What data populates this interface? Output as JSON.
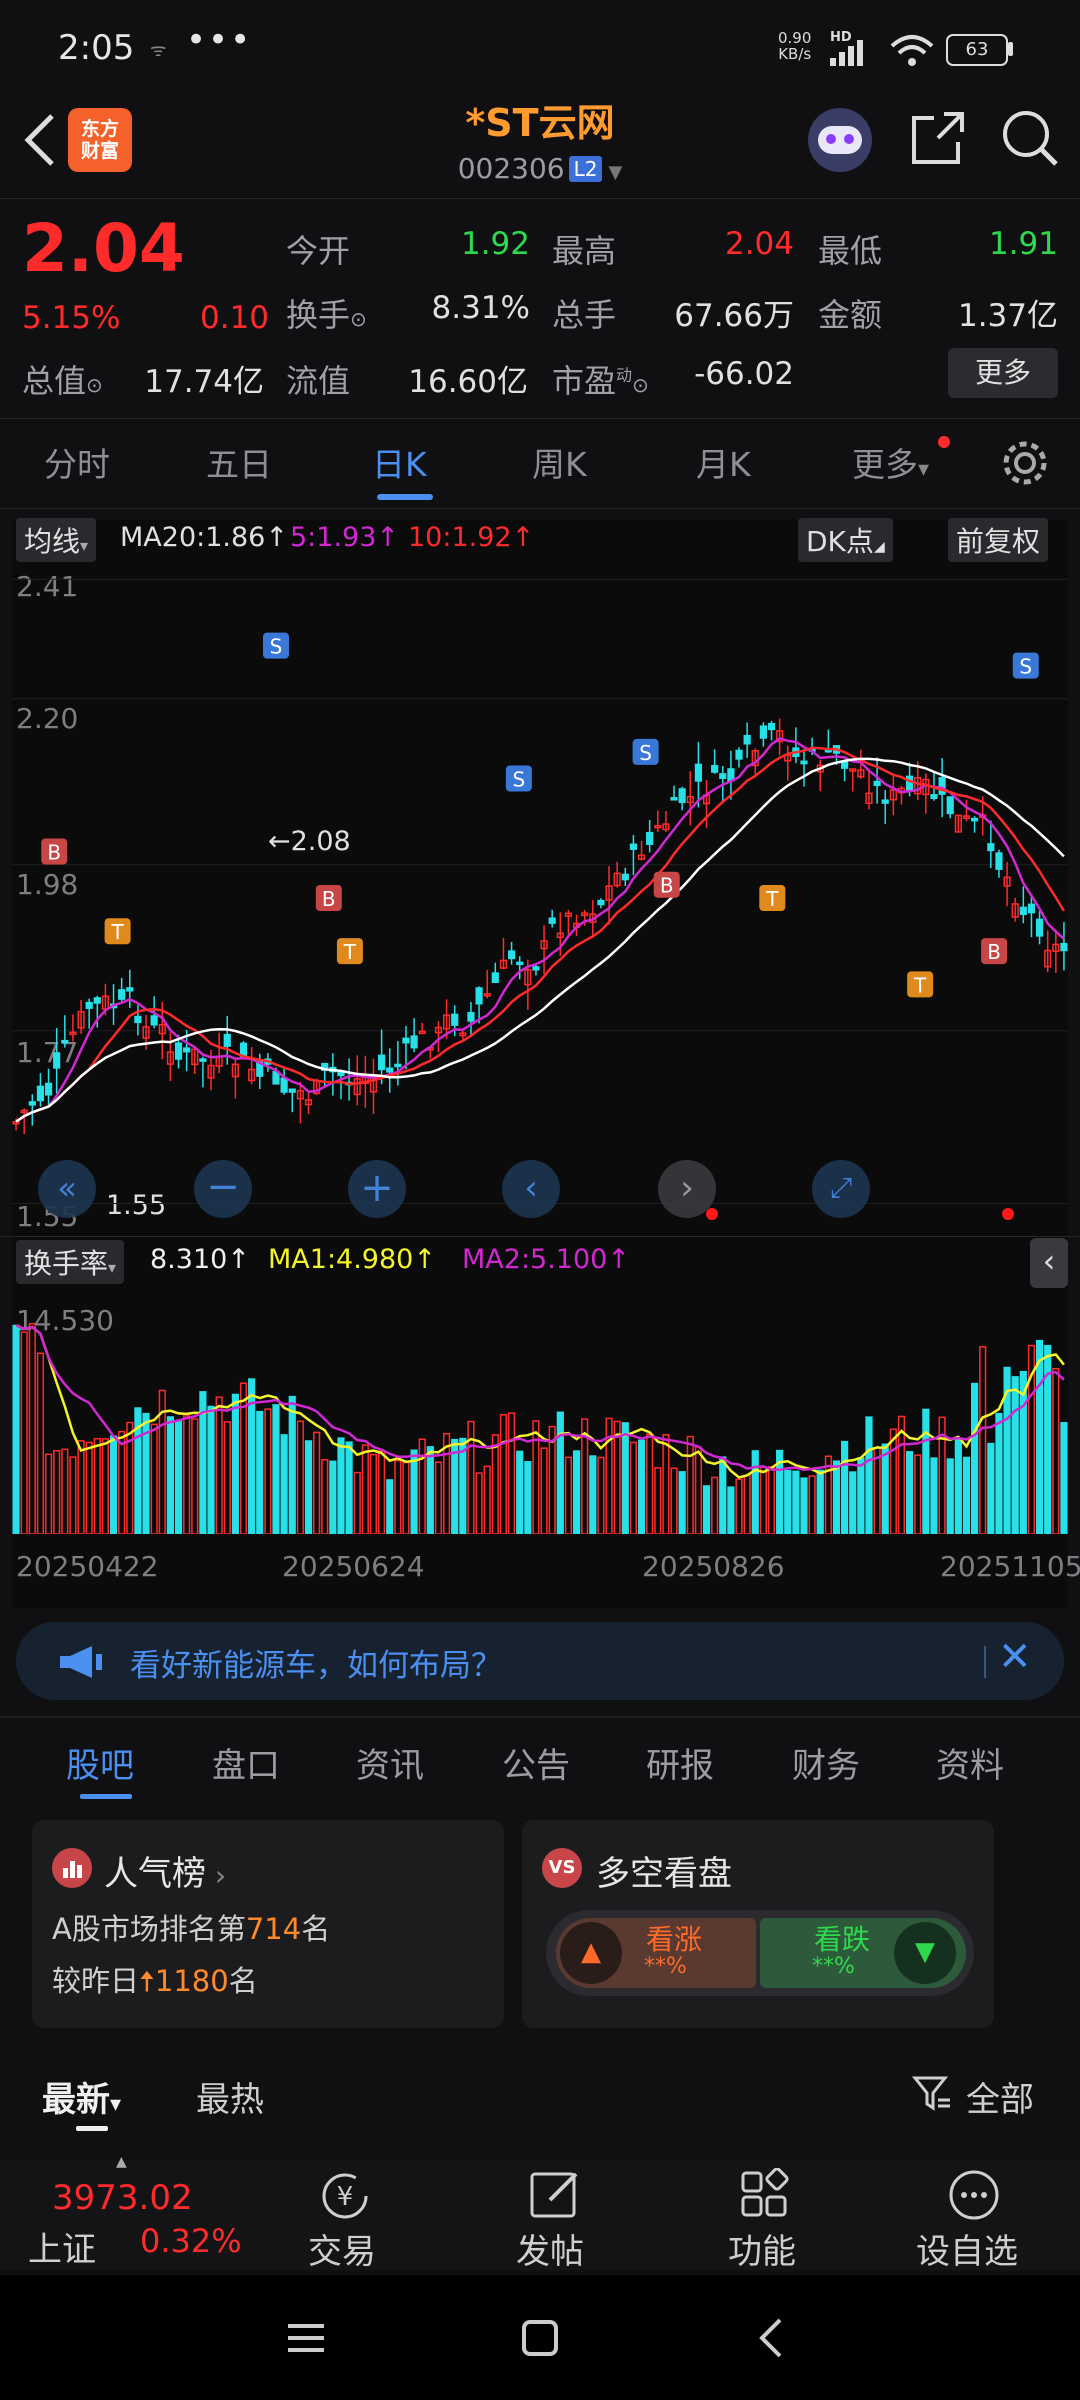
{
  "status_bar": {
    "time": "2:05",
    "net_speed": "0.90",
    "net_unit": "KB/s",
    "hd": "HD",
    "battery": "63"
  },
  "header": {
    "logo_text_1": "东方",
    "logo_text_2": "财富",
    "stock_name": "*ST云网",
    "stock_code": "002306",
    "level": "L2"
  },
  "quote": {
    "price": "2.04",
    "change_pct": "5.15%",
    "change_amt": "0.10",
    "open_label": "今开",
    "open": "1.92",
    "high_label": "最高",
    "high": "2.04",
    "low_label": "最低",
    "low": "1.91",
    "turnover_label": "换手",
    "turnover": "8.31%",
    "volume_label": "总手",
    "volume": "67.66万",
    "amount_label": "金额",
    "amount": "1.37亿",
    "total_mv_label": "总值",
    "total_mv": "17.74亿",
    "float_mv_label": "流值",
    "float_mv": "16.60亿",
    "pe_label": "市盈",
    "pe_sup": "动",
    "pe": "-66.02",
    "more_button": "更多"
  },
  "chart_tabs": [
    "分时",
    "五日",
    "日K",
    "周K",
    "月K",
    "更多"
  ],
  "kline": {
    "ma_selector": "均线",
    "ma20": "MA20:1.86",
    "ma5": "5:1.93",
    "ma10": "10:1.92",
    "dk_button": "DK点",
    "adjust_button": "前复权",
    "y_labels": [
      "2.41",
      "2.20",
      "1.98",
      "1.77",
      "1.55"
    ],
    "high_marker": "←2.08",
    "low_marker": "1.55"
  },
  "turnover": {
    "selector": "换手率",
    "value": "8.310",
    "ma1": "MA1:4.980",
    "ma2": "MA2:5.100",
    "y_max": "14.530",
    "dates": [
      "20250422",
      "20250624",
      "20250826",
      "20251105"
    ]
  },
  "colors": {
    "up": "#ff2b2b",
    "down": "#2fd94d",
    "accent": "#4b8ff0",
    "title": "#ff9b2f",
    "cyan": "#27e0e8",
    "ma_yellow": "#f4f42a",
    "ma_magenta": "#d228d2"
  },
  "ad_banner": {
    "text": "看好新能源车，如何布局？"
  },
  "section_tabs": [
    "股吧",
    "盘口",
    "资讯",
    "公告",
    "研报",
    "财务",
    "资料"
  ],
  "popularity": {
    "title": "人气榜",
    "rank_prefix": "A股市场排名第",
    "rank": "714",
    "rank_suffix": "名",
    "change_prefix": "较昨日",
    "change": "1180",
    "change_suffix": "名"
  },
  "sentiment": {
    "title": "多空看盘",
    "bull_label": "看涨",
    "bear_label": "看跌",
    "bull_pct": "**%",
    "bear_pct": "**%"
  },
  "feed_tabs": {
    "latest": "最新",
    "hot": "最热",
    "filter": "全部"
  },
  "footer": {
    "index_value": "3973.02",
    "index_name": "上证",
    "index_change": "0.32%",
    "trade": "交易",
    "post": "发帖",
    "functions": "功能",
    "watchlist": "设自选"
  }
}
